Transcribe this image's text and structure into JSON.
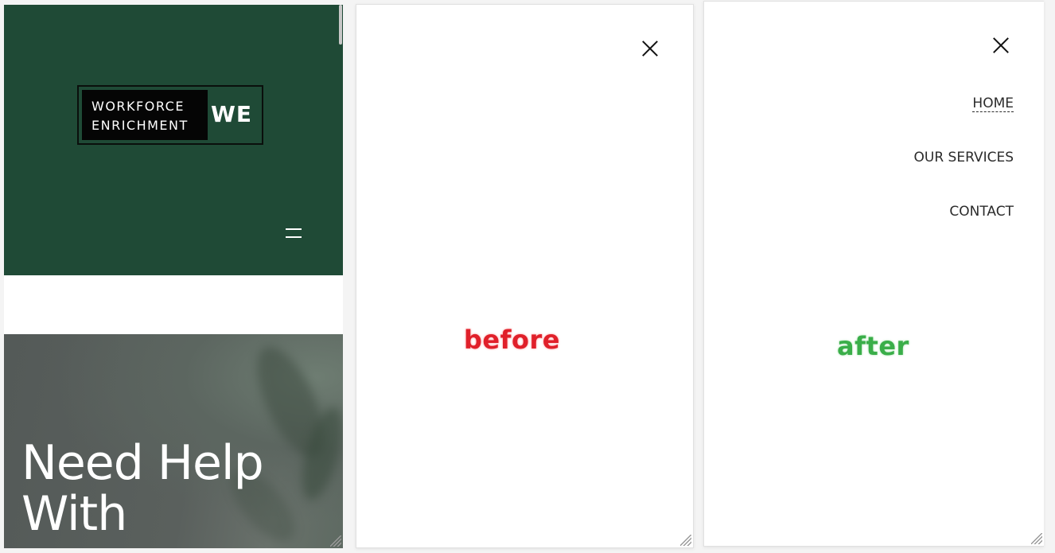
{
  "site": {
    "logo": {
      "line1": "WORKFORCE",
      "line2": "ENRICHMENT",
      "mark": "WE"
    },
    "hero_title": "Need Help With",
    "colors": {
      "header_bg": "#1f4a36",
      "hero_overlay": "#5a605d"
    },
    "hamburger_icon": "hamburger-menu-icon"
  },
  "drawer_before": {
    "label": "before",
    "close_icon": "close-icon"
  },
  "drawer_after": {
    "label": "after",
    "close_icon": "close-icon",
    "menu": [
      {
        "label": "HOME",
        "active": true
      },
      {
        "label": "OUR SERVICES",
        "active": false
      },
      {
        "label": "CONTACT",
        "active": false
      }
    ]
  },
  "annotation_colors": {
    "before": "#e0202a",
    "after": "#3aae49"
  }
}
